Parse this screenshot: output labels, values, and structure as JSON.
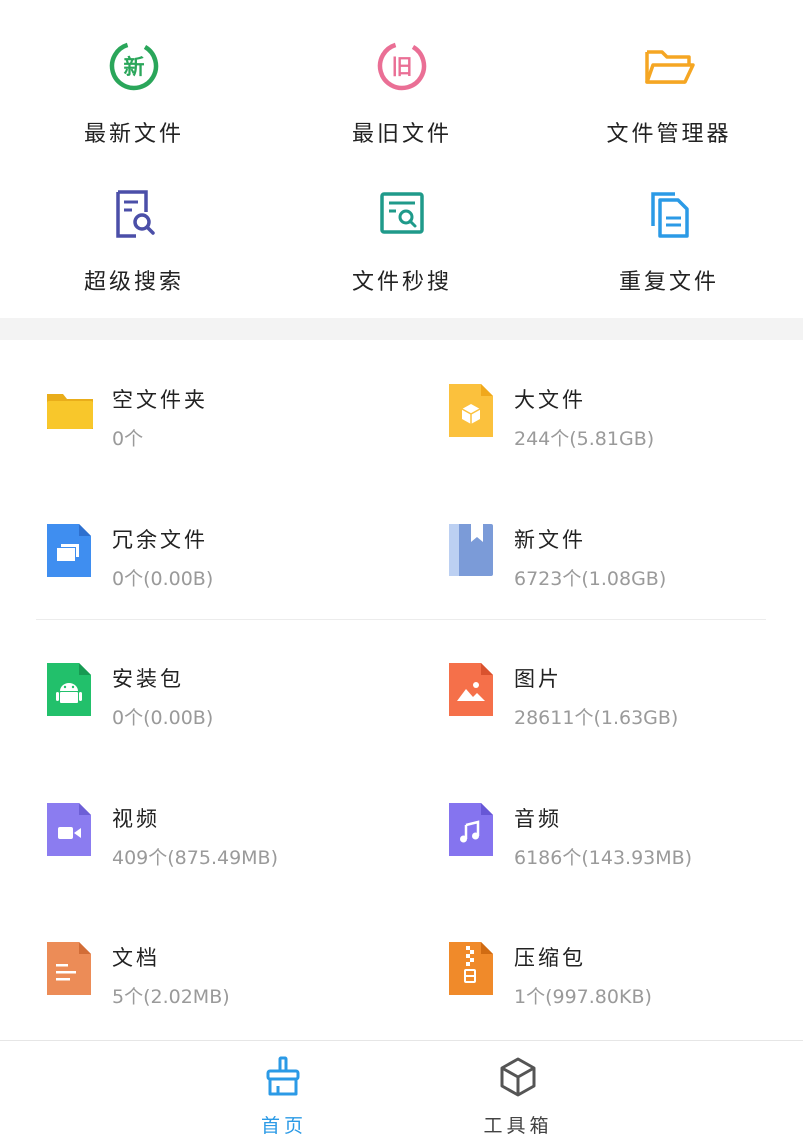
{
  "quick_tools": [
    {
      "label": "最新文件",
      "icon": "new-badge-icon",
      "glyph": "新",
      "color": "#2aa65a"
    },
    {
      "label": "最旧文件",
      "icon": "old-badge-icon",
      "glyph": "旧",
      "color": "#ea6f95"
    },
    {
      "label": "文件管理器",
      "icon": "folder-outline-icon",
      "color": "#f5a623"
    },
    {
      "label": "超级搜索",
      "icon": "doc-search-icon",
      "color": "#4b4fa8"
    },
    {
      "label": "文件秒搜",
      "icon": "quick-search-icon",
      "color": "#1f9a8a"
    },
    {
      "label": "重复文件",
      "icon": "duplicate-files-icon",
      "color": "#2b9ae6"
    }
  ],
  "categories": [
    {
      "name": "空文件夹",
      "info": "0个",
      "icon": "yellow-folder-icon",
      "color": "#f8c72b"
    },
    {
      "name": "大文件",
      "info": "244个(5.81GB)",
      "icon": "large-file-icon",
      "color": "#fbc13d"
    },
    {
      "name": "冗余文件",
      "info": "0个(0.00B)",
      "icon": "redundant-file-icon",
      "color": "#3f8ef0"
    },
    {
      "name": "新文件",
      "info": "6723个(1.08GB)",
      "icon": "new-file-book-icon",
      "color": "#7b9bd8"
    },
    {
      "name": "安装包",
      "info": "0个(0.00B)",
      "icon": "apk-android-icon",
      "color": "#22c06b"
    },
    {
      "name": "图片",
      "info": "28611个(1.63GB)",
      "icon": "image-file-icon",
      "color": "#f5704a"
    },
    {
      "name": "视频",
      "info": "409个(875.49MB)",
      "icon": "video-file-icon",
      "color": "#8b7cf0"
    },
    {
      "name": "音频",
      "info": "6186个(143.93MB)",
      "icon": "audio-file-icon",
      "color": "#8574ef"
    },
    {
      "name": "文档",
      "info": "5个(2.02MB)",
      "icon": "document-file-icon",
      "color": "#ec8c57"
    },
    {
      "name": "压缩包",
      "info": "1个(997.80KB)",
      "icon": "zip-file-icon",
      "color": "#f08a2a"
    }
  ],
  "tabbar": {
    "home_label": "首页",
    "toolbox_label": "工具箱",
    "active_color": "#2b9ae6"
  }
}
